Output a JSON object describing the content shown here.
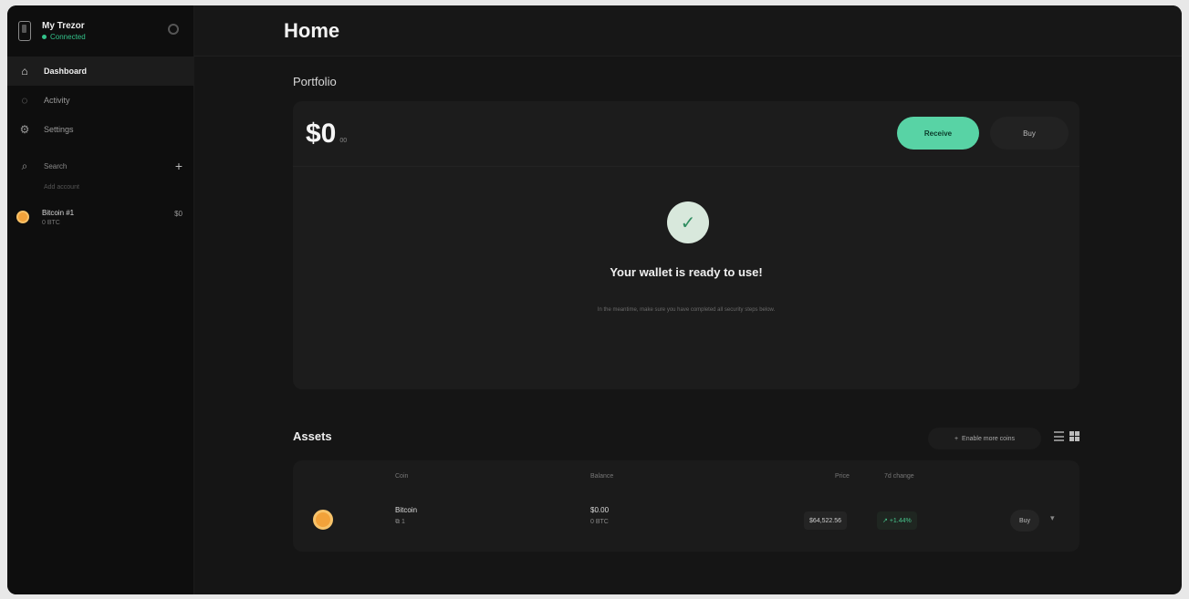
{
  "page": {
    "title": "Home"
  },
  "sidebar": {
    "device": {
      "name": "My Trezor",
      "status": "Connected"
    },
    "nav": [
      {
        "label": "Dashboard",
        "icon": "home-icon",
        "active": true
      },
      {
        "label": "Activity",
        "icon": "activity-icon",
        "active": false
      },
      {
        "label": "Settings",
        "icon": "gear-icon",
        "active": false
      }
    ],
    "section": {
      "label": "Search",
      "sub": "Add account"
    },
    "account": {
      "name": "Bitcoin #1",
      "sub": "0 BTC",
      "button": "$0"
    }
  },
  "portfolio": {
    "heading": "Portfolio",
    "balance": "$0",
    "balance_unit": "00",
    "receive_label": "Receive",
    "buy_label": "Buy",
    "ready_title": "Your wallet is ready to use!",
    "ready_sub": "In the meantime, make sure you have completed all security steps below."
  },
  "assets": {
    "heading": "Assets",
    "enable_label": "Enable more coins",
    "columns": {
      "coin": "Coin",
      "balance": "Balance",
      "price": "Price",
      "change": "7d change"
    },
    "rows": [
      {
        "name": "Bitcoin",
        "accounts": "1",
        "balance_fiat": "$0.00",
        "balance_crypto": "0 BTC",
        "price": "$64,522.56",
        "change": "+1.44%",
        "buy_label": "Buy"
      }
    ]
  },
  "colors": {
    "accent": "#58d3a5",
    "bitcoin": "#f2a23a",
    "positive": "#47c48c"
  }
}
